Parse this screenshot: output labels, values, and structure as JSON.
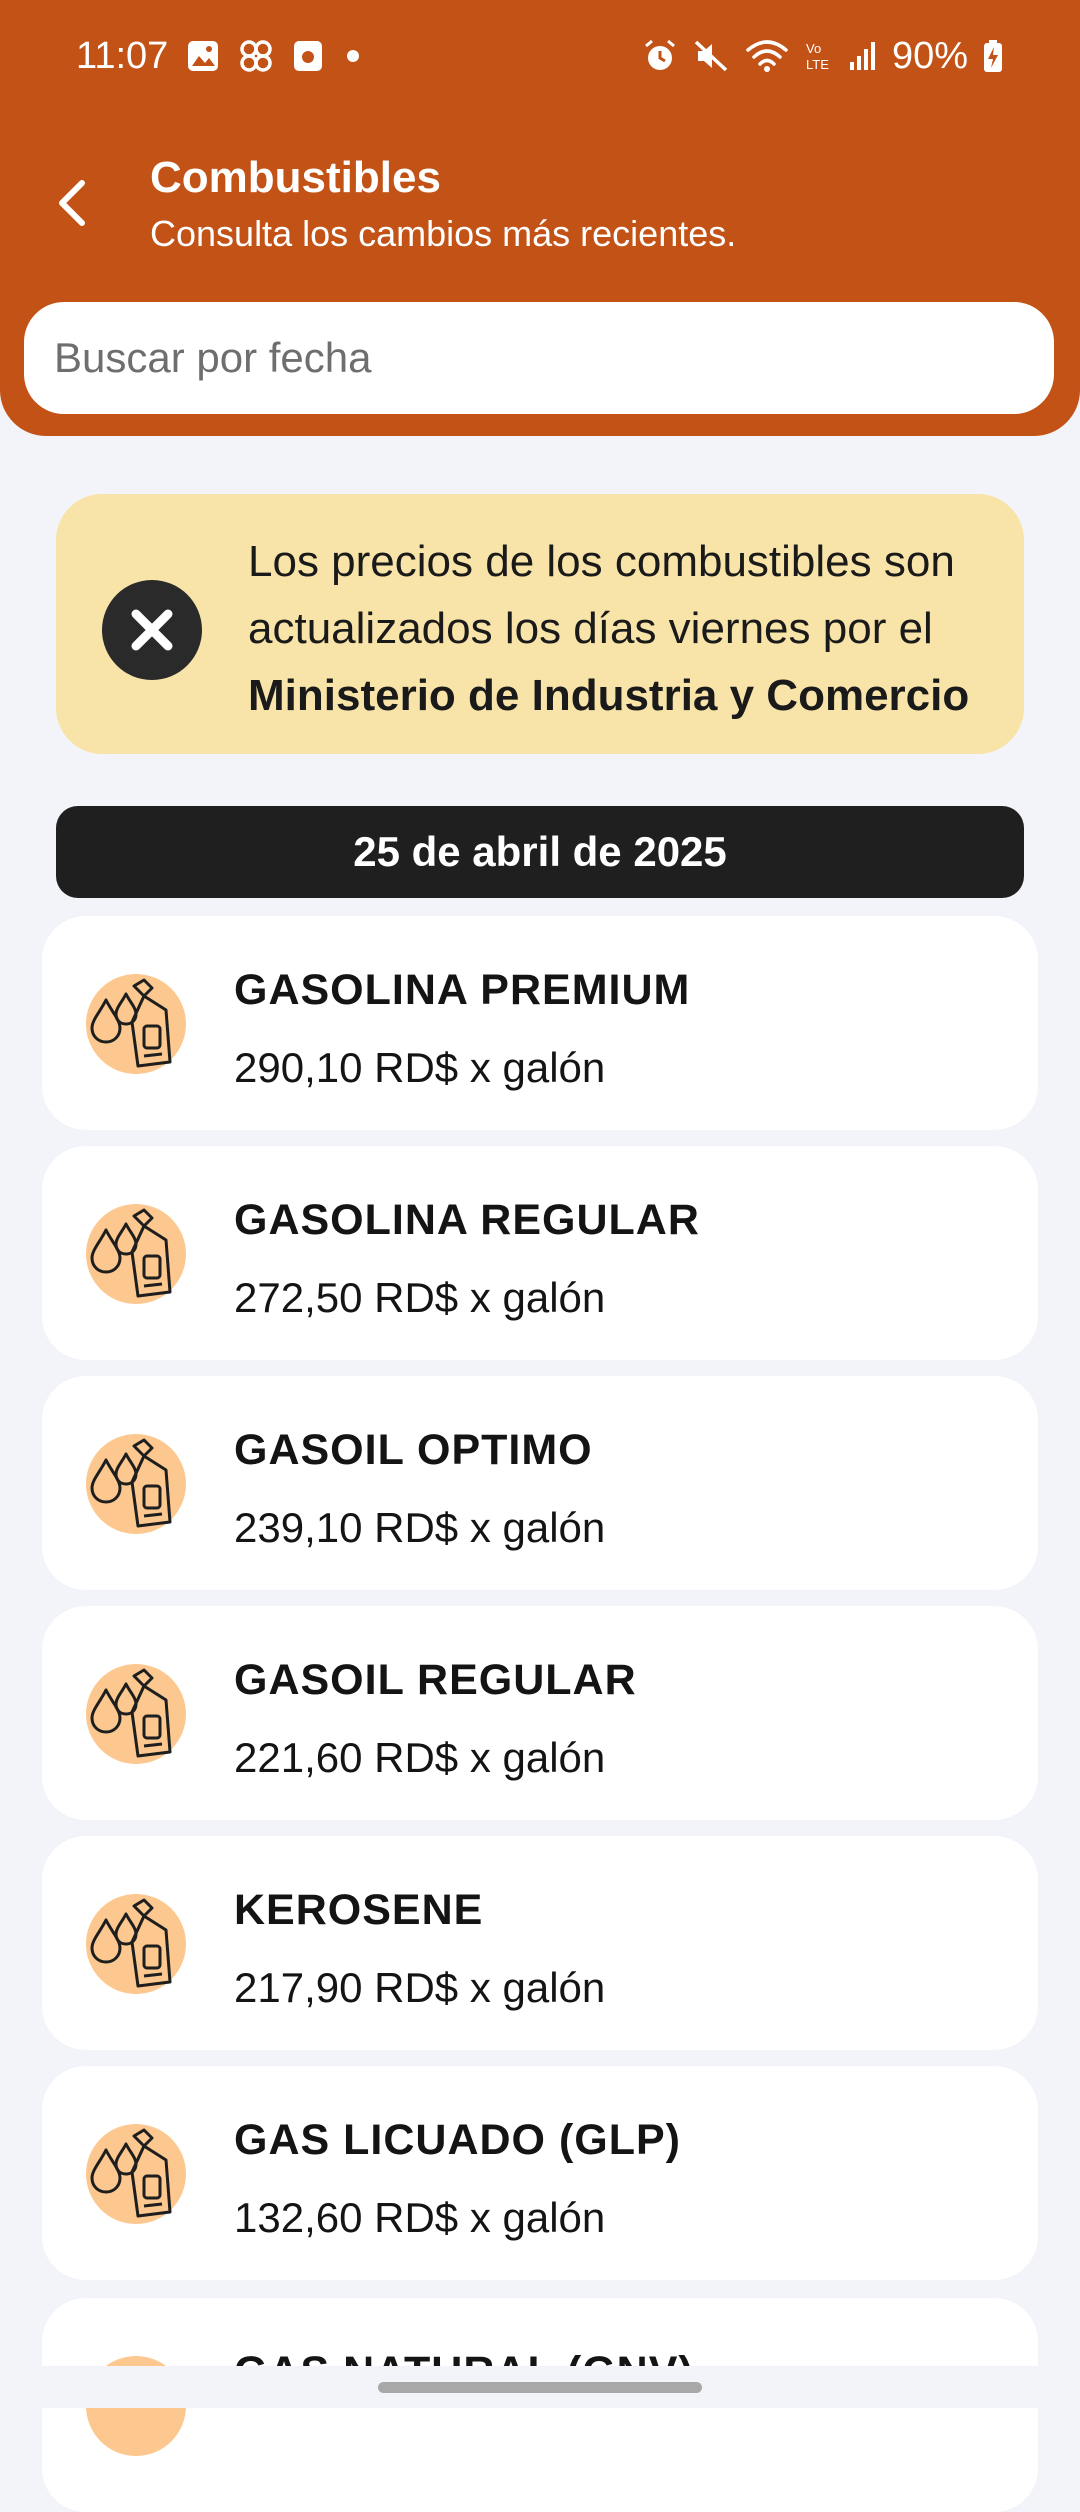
{
  "status_bar": {
    "time": "11:07",
    "battery": "90%"
  },
  "header": {
    "title": "Combustibles",
    "subtitle": "Consulta los cambios más recientes."
  },
  "search": {
    "placeholder": "Buscar por fecha"
  },
  "notice": {
    "text_part1": "Los precios de los combustibles son actualizados los días viernes por el ",
    "text_bold": "Ministerio de Industria y Comercio"
  },
  "date_label": "25 de abril de 2025",
  "fuels": [
    {
      "name": "GASOLINA PREMIUM",
      "price": "290,10 RD$ x galón"
    },
    {
      "name": "GASOLINA REGULAR",
      "price": "272,50 RD$ x galón"
    },
    {
      "name": "GASOIL OPTIMO",
      "price": "239,10 RD$ x galón"
    },
    {
      "name": "GASOIL REGULAR",
      "price": "221,60 RD$ x galón"
    },
    {
      "name": "KEROSENE",
      "price": "217,90 RD$ x galón"
    },
    {
      "name": "GAS LICUADO (GLP)",
      "price": "132,60 RD$ x galón"
    },
    {
      "name": "GAS NATURAL (GNV)",
      "price": ""
    }
  ],
  "colors": {
    "header": "#c25216",
    "notice_bg": "#f8e4a8",
    "date_bg": "#1f1f1f",
    "icon_bg": "#fcc88f",
    "page_bg": "#f3f4f9"
  }
}
